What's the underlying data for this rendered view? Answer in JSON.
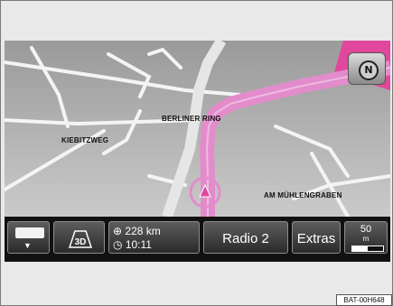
{
  "map": {
    "streets": {
      "berliner_ring": "BERLINER RING",
      "kiebitzweg": "KIEBITZWEG",
      "am_muehlengraben": "AM MÜHLENGRABEN"
    },
    "compass_label": "N",
    "route_color": "#e38ccc",
    "destination_color": "#e0479d"
  },
  "toolbar": {
    "menu_icon": "list-menu-icon",
    "view_mode_label": "3D",
    "distance_value": "228",
    "distance_unit": "km",
    "arrival_time": "10:11",
    "radio_label": "Radio 2",
    "extras_label": "Extras",
    "scale_value": "50",
    "scale_unit": "m"
  },
  "figure_code": "BAT-00H648"
}
